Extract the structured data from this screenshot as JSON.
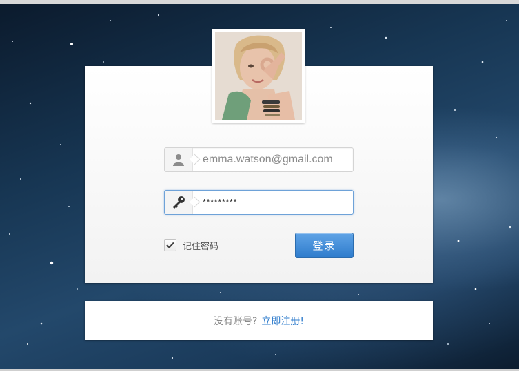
{
  "login": {
    "email_value": "emma.watson@gmail.com",
    "password_value": "*********",
    "remember_label": "记住密码",
    "remember_checked": true,
    "submit_label": "登录"
  },
  "register": {
    "prompt": "没有账号?",
    "link_label": "立即注册!"
  },
  "icons": {
    "email_field": "user-icon",
    "password_field": "key-icon",
    "remember": "checkmark-icon"
  },
  "colors": {
    "button": "#3d8bd6",
    "link": "#2f7ccc",
    "focus_border": "#6ea2d8"
  }
}
